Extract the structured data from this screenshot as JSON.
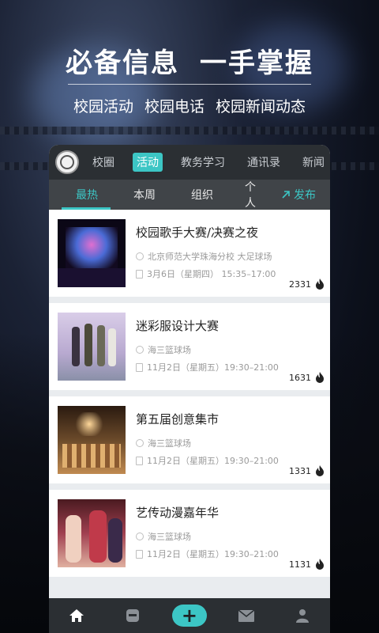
{
  "hero": {
    "headline_left": "必备信息",
    "headline_right": "一手掌握",
    "sub_items": [
      "校园活动",
      "校园电话",
      "校园新闻动态"
    ]
  },
  "nav": {
    "items": [
      "校圈",
      "活动",
      "教务学习",
      "通讯录",
      "新闻"
    ],
    "active_index": 1
  },
  "subtabs": {
    "items": [
      "最热",
      "本周",
      "组织",
      "个人"
    ],
    "publish": "发布"
  },
  "events": [
    {
      "title": "校园歌手大赛/决赛之夜",
      "location": "北京师范大学珠海分校 大足球场",
      "time": "3月6日（星期四） 15:35–17:00",
      "heat": "2331"
    },
    {
      "title": "迷彩服设计大赛",
      "location": "海三篮球场",
      "time": "11月2日（星期五）19:30–21:00",
      "heat": "1631"
    },
    {
      "title": "第五届创意集市",
      "location": "海三篮球场",
      "time": "11月2日（星期五）19:30–21:00",
      "heat": "1331"
    },
    {
      "title": "艺传动漫嘉年华",
      "location": "海三篮球场",
      "time": "11月2日（星期五）19:30–21:00",
      "heat": "1131"
    }
  ],
  "bottombar": {
    "add_symbol": "+",
    "icons": [
      "home-icon",
      "card-icon",
      "add-icon",
      "mail-icon",
      "profile-icon"
    ]
  },
  "colors": {
    "accent": "#3cc6c5",
    "nav_bg": "#2b2f33",
    "subtab_bg": "#404448",
    "list_bg": "#e9ecef"
  }
}
